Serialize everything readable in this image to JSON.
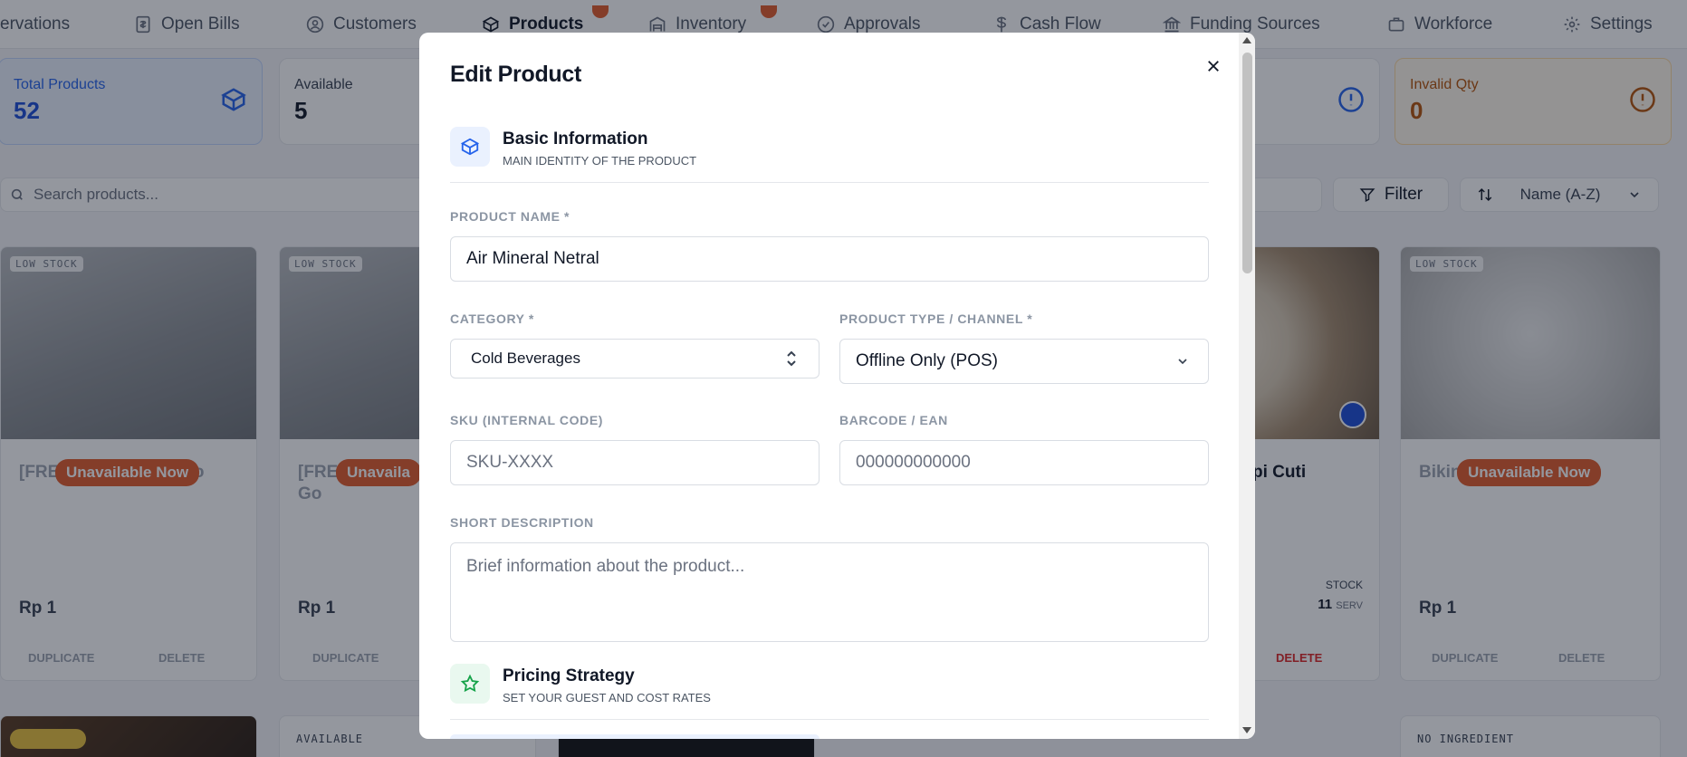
{
  "nav": {
    "items": [
      {
        "label": "ervations",
        "icon": "calendar-icon"
      },
      {
        "label": "Open Bills",
        "icon": "dollar-doc-icon"
      },
      {
        "label": "Customers",
        "icon": "user-circle-icon"
      },
      {
        "label": "Products",
        "icon": "box-icon",
        "active": true
      },
      {
        "label": "Inventory",
        "icon": "warehouse-icon"
      },
      {
        "label": "Approvals",
        "icon": "check-circle-icon"
      },
      {
        "label": "Cash Flow",
        "icon": "dollar-icon"
      },
      {
        "label": "Funding Sources",
        "icon": "bank-icon"
      },
      {
        "label": "Workforce",
        "icon": "briefcase-icon"
      },
      {
        "label": "Settings",
        "icon": "gear-icon"
      }
    ]
  },
  "stats": {
    "total_label": "Total Products",
    "total_value": "52",
    "available_label": "Available",
    "available_value": "5",
    "invalid_label": "Invalid Qty",
    "invalid_value": "0"
  },
  "toolbar": {
    "search_placeholder": "Search products...",
    "filter_label": "Filter",
    "sort_label": "Name (A-Z)"
  },
  "cards": {
    "low_stock": "LOW STOCK",
    "unavailable": "Unavailable Now",
    "card1_title": "[FRE",
    "card1_title_end": "mo",
    "card2_title": "[FRE",
    "card2_title2": "Go",
    "card2_unavailable": "Unavaila",
    "card3_title": "pi Cuti",
    "card4_title": "Bikin",
    "price": "Rp 1",
    "stock_label": "STOCK",
    "stock_value_a": "11",
    "stock_unit": "SERV",
    "duplicate": "DUPLICATE",
    "delete": "DELETE",
    "row2_tag_a": "AVAILABLE",
    "row2_tag_b": "NO INGREDIENT"
  },
  "modal": {
    "title": "Edit Product",
    "basic_section": {
      "title": "Basic Information",
      "subtitle": "MAIN IDENTITY OF THE PRODUCT"
    },
    "product_name_label": "PRODUCT NAME *",
    "product_name_value": "Air Mineral Netral",
    "category_label": "CATEGORY *",
    "category_value": "Cold Beverages",
    "product_type_label": "PRODUCT TYPE / CHANNEL *",
    "product_type_value": "Offline Only (POS)",
    "sku_label": "SKU (INTERNAL CODE)",
    "sku_placeholder": "SKU-XXXX",
    "barcode_label": "BARCODE / EAN",
    "barcode_placeholder": "000000000000",
    "description_label": "SHORT DESCRIPTION",
    "description_placeholder": "Brief information about the product...",
    "pricing_section": {
      "title": "Pricing Strategy",
      "subtitle": "SET YOUR GUEST AND COST RATES"
    }
  },
  "colors": {
    "accent_blue": "#2563eb",
    "brand_orange": "#e25c2b",
    "pricing_green": "#16a34a"
  }
}
